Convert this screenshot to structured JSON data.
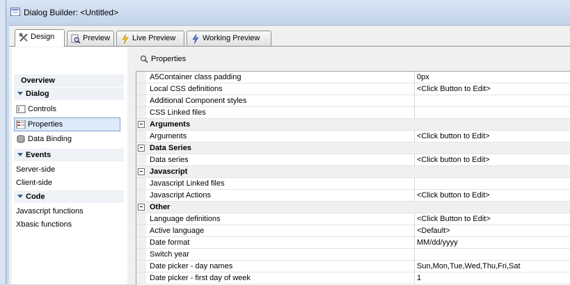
{
  "window": {
    "title": "Dialog Builder: <Untitled>"
  },
  "tabs": [
    {
      "label": "Design",
      "icon": "tools-icon",
      "active": true
    },
    {
      "label": "Preview",
      "icon": "magnifier-page-icon",
      "active": false
    },
    {
      "label": "Live Preview",
      "icon": "lightning-icon",
      "active": false
    },
    {
      "label": "Working Preview",
      "icon": "lightning-blue-icon",
      "active": false
    }
  ],
  "sidebar": {
    "overview": "Overview",
    "dialog": "Dialog",
    "controls": "Controls",
    "properties": "Properties",
    "data_binding": "Data Binding",
    "events": "Events",
    "server_side": "Server-side",
    "client_side": "Client-side",
    "code": "Code",
    "javascript_functions": "Javascript functions",
    "xbasic_functions": "Xbasic functions"
  },
  "properties": {
    "header": "Properties",
    "rows": [
      {
        "type": "prop",
        "name": "A5Container class padding",
        "value": "0px"
      },
      {
        "type": "prop",
        "name": "Local CSS definitions",
        "value": "<Click Button to Edit>"
      },
      {
        "type": "prop",
        "name": "Additional Component styles",
        "value": ""
      },
      {
        "type": "prop",
        "name": "CSS Linked files",
        "value": ""
      },
      {
        "type": "cat",
        "name": "Arguments"
      },
      {
        "type": "prop",
        "name": "Arguments",
        "value": "<Click button to Edit>"
      },
      {
        "type": "cat",
        "name": "Data Series"
      },
      {
        "type": "prop",
        "name": "Data series",
        "value": "<Click button to Edit>"
      },
      {
        "type": "cat",
        "name": "Javascript"
      },
      {
        "type": "prop",
        "name": "Javascript Linked files",
        "value": ""
      },
      {
        "type": "prop",
        "name": "Javascript Actions",
        "value": "<Click button to Edit>"
      },
      {
        "type": "cat",
        "name": "Other"
      },
      {
        "type": "prop",
        "name": "Language definitions",
        "value": "<Click Button to Edit>"
      },
      {
        "type": "prop",
        "name": "Active language",
        "value": "<Default>"
      },
      {
        "type": "prop",
        "name": "Date format",
        "value": "MM/dd/yyyy"
      },
      {
        "type": "prop",
        "name": "Switch year",
        "value": ""
      },
      {
        "type": "prop",
        "name": "Date picker - day names",
        "value": "Sun,Mon,Tue,Wed,Thu,Fri,Sat"
      },
      {
        "type": "prop",
        "name": "Date picker - first day of week",
        "value": "1"
      }
    ]
  }
}
